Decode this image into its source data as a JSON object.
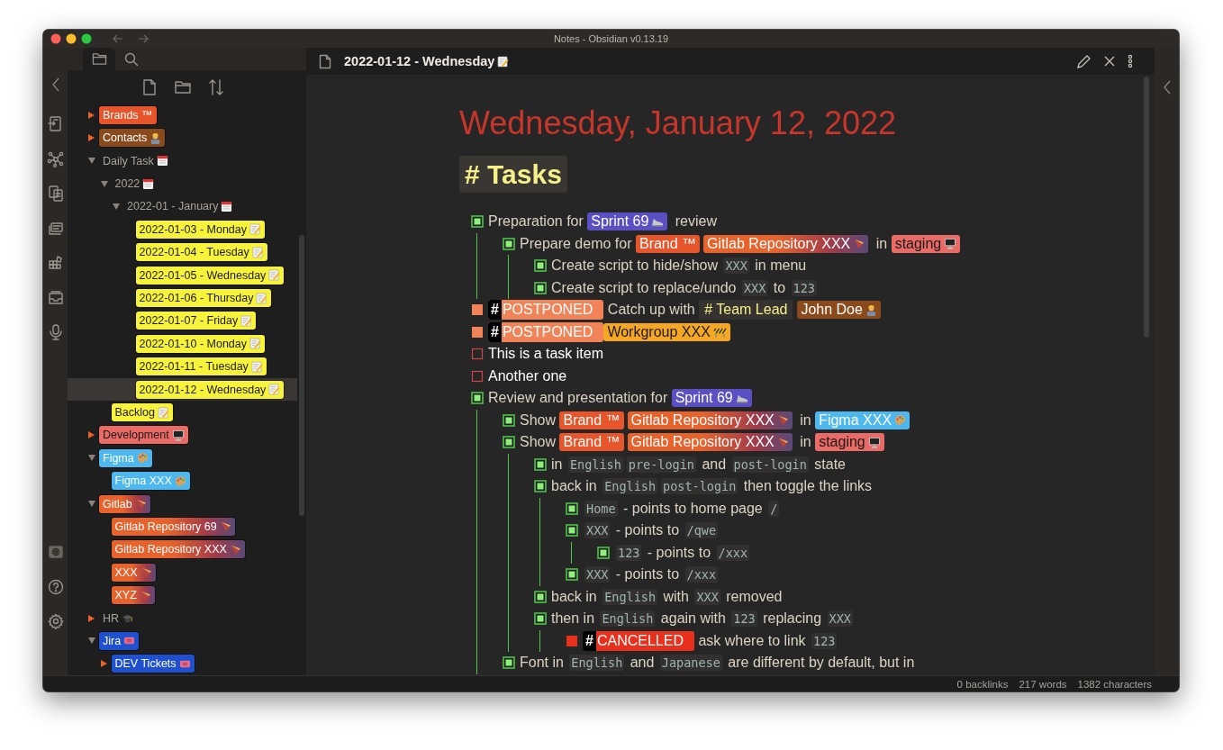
{
  "window": {
    "title": "Notes - Obsidian v0.13.19"
  },
  "sidebar_tabs": [
    {
      "kind": "files",
      "selected": true
    },
    {
      "kind": "search",
      "selected": false
    }
  ],
  "file_tree": [
    {
      "label": "Brands ™",
      "color": "#e8552a",
      "expanded": false,
      "selected": false
    },
    {
      "label": "Contacts",
      "icon": {
        "kind": "worker"
      },
      "color": "#8a4a1c",
      "expanded": false,
      "selected": false
    },
    {
      "label": "Daily Task",
      "icon": {
        "kind": "calendar"
      },
      "expanded": true,
      "selected": false,
      "children": [
        {
          "label": "2022",
          "icon": {
            "kind": "calendar"
          },
          "expanded": true,
          "selected": false,
          "children": [
            {
              "label": "2022-01 - January",
              "icon": {
                "kind": "calendar"
              },
              "expanded": true,
              "selected": false,
              "children": [
                {
                  "label": "2022-01-03 - Monday",
                  "icon": {
                    "kind": "note"
                  },
                  "color": "#f7f23a",
                  "selected": false
                },
                {
                  "label": "2022-01-04 - Tuesday",
                  "icon": {
                    "kind": "note"
                  },
                  "color": "#f7f23a",
                  "selected": false
                },
                {
                  "label": "2022-01-05 - Wednesday",
                  "icon": {
                    "kind": "note"
                  },
                  "color": "#f7f23a",
                  "selected": false
                },
                {
                  "label": "2022-01-06 - Thursday",
                  "icon": {
                    "kind": "note"
                  },
                  "color": "#f7f23a",
                  "selected": false
                },
                {
                  "label": "2022-01-07 - Friday",
                  "icon": {
                    "kind": "note"
                  },
                  "color": "#f7f23a",
                  "selected": false
                },
                {
                  "label": "2022-01-10 - Monday",
                  "icon": {
                    "kind": "note"
                  },
                  "color": "#f7f23a",
                  "selected": false
                },
                {
                  "label": "2022-01-11 - Tuesday",
                  "icon": {
                    "kind": "note"
                  },
                  "color": "#f7f23a",
                  "selected": false
                },
                {
                  "label": "2022-01-12 - Wednesday",
                  "icon": {
                    "kind": "note"
                  },
                  "color": "#f7f23a",
                  "selected": true
                }
              ]
            }
          ]
        },
        {
          "label": "Backlog",
          "icon": {
            "kind": "note"
          },
          "color": "#f7f23a",
          "selected": false
        }
      ]
    },
    {
      "label": "Development",
      "icon": {
        "kind": "monitor"
      },
      "color": "#ea6a66",
      "expanded": false,
      "selected": false
    },
    {
      "label": "Figma",
      "icon": {
        "kind": "palette"
      },
      "color": "#4db8f0",
      "expanded": true,
      "selected": false,
      "children": [
        {
          "label": "Figma XXX",
          "icon": {
            "kind": "palette"
          },
          "color": "#4db8f0",
          "selected": false
        }
      ]
    },
    {
      "label": "Gitlab",
      "icon": {
        "kind": "cone"
      },
      "color": "#e8622c",
      "gradient": true,
      "expanded": true,
      "selected": false,
      "children": [
        {
          "label": "Gitlab Repository 69",
          "icon": {
            "kind": "cone"
          },
          "color": "#e8622c",
          "gradient": true,
          "selected": false
        },
        {
          "label": "Gitlab Repository XXX",
          "icon": {
            "kind": "cone"
          },
          "color": "#e8622c",
          "gradient": true,
          "selected": false
        },
        {
          "label": "XXX",
          "icon": {
            "kind": "cone"
          },
          "color": "#e8622c",
          "gradient": true,
          "selected": false
        },
        {
          "label": "XYZ",
          "icon": {
            "kind": "cone"
          },
          "color": "#e8622c",
          "gradient": true,
          "selected": false
        }
      ]
    },
    {
      "label": "HR",
      "icon": {
        "kind": "cap"
      },
      "expanded": false,
      "selected": false
    },
    {
      "label": "Jira",
      "icon": {
        "kind": "ticket"
      },
      "color": "#1e50d0",
      "expanded": true,
      "selected": false,
      "children": [
        {
          "label": "DEV Tickets",
          "icon": {
            "kind": "ticket"
          },
          "color": "#1e50d0",
          "expanded": false,
          "selected": false
        }
      ]
    }
  ],
  "editor": {
    "tab_title": "2022-01-12 - Wednesday",
    "tab_icon": {
      "kind": "note"
    },
    "heading": "Wednesday, January 12, 2022",
    "section": "# Tasks",
    "tasks": [
      {
        "kind": "done",
        "parts": [
          {
            "kind": "text",
            "text": "Preparation for "
          },
          {
            "kind": "link",
            "text": "Sprint 69",
            "icon": {
              "kind": "shoe"
            },
            "color": "#5b4fc4"
          },
          {
            "kind": "text",
            "text": " review"
          }
        ],
        "children": [
          {
            "kind": "done",
            "parts": [
              {
                "kind": "text",
                "text": "Prepare demo for "
              },
              {
                "kind": "link",
                "text": "Brand ™",
                "color": "#e8552a"
              },
              {
                "kind": "link",
                "text": "Gitlab Repository XXX",
                "icon": {
                  "kind": "cone"
                },
                "color": "#e8622c",
                "gradient": true
              },
              {
                "kind": "text",
                "text": " in "
              },
              {
                "kind": "link",
                "text": "staging",
                "icon": {
                  "kind": "monitor"
                },
                "color": "#ea6a66"
              }
            ],
            "children": [
              {
                "kind": "done",
                "parts": [
                  {
                    "kind": "text",
                    "text": "Create script to hide/show "
                  },
                  {
                    "kind": "code",
                    "text": "XXX"
                  },
                  {
                    "kind": "text",
                    "text": " in menu"
                  }
                ]
              },
              {
                "kind": "done",
                "parts": [
                  {
                    "kind": "text",
                    "text": "Create script to replace/undo "
                  },
                  {
                    "kind": "code",
                    "text": "XXX"
                  },
                  {
                    "kind": "text",
                    "text": " to "
                  },
                  {
                    "kind": "code",
                    "text": "123"
                  }
                ]
              }
            ]
          }
        ]
      },
      {
        "kind": "postponed",
        "parts": [
          {
            "kind": "status-tag",
            "mark": "#",
            "text": "POSTPONED",
            "color": "#f08458"
          },
          {
            "kind": "text",
            "text": " Catch up with "
          },
          {
            "kind": "hashtag",
            "text": "# Team Lead"
          },
          {
            "kind": "link",
            "text": "John Doe",
            "icon": {
              "kind": "worker"
            },
            "color": "#8a4a1c"
          }
        ]
      },
      {
        "kind": "postponed",
        "parts": [
          {
            "kind": "status-tag",
            "mark": "#",
            "text": "POSTPONED",
            "color": "#f08458"
          },
          {
            "kind": "link",
            "text": "Workgroup XXX",
            "icon": {
              "kind": "barrier"
            },
            "color": "#f5a623"
          }
        ]
      },
      {
        "kind": "todo",
        "parts": [
          {
            "kind": "text",
            "text": "This is a task item"
          }
        ]
      },
      {
        "kind": "todo",
        "parts": [
          {
            "kind": "text",
            "text": "Another one"
          }
        ]
      },
      {
        "kind": "done",
        "parts": [
          {
            "kind": "text",
            "text": "Review and presentation for "
          },
          {
            "kind": "link",
            "text": "Sprint 69",
            "icon": {
              "kind": "shoe"
            },
            "color": "#5b4fc4"
          }
        ],
        "children": [
          {
            "kind": "done",
            "parts": [
              {
                "kind": "text",
                "text": "Show "
              },
              {
                "kind": "link",
                "text": "Brand ™",
                "color": "#e8552a"
              },
              {
                "kind": "link",
                "text": "Gitlab Repository XXX",
                "icon": {
                  "kind": "cone"
                },
                "color": "#e8622c",
                "gradient": true
              },
              {
                "kind": "text",
                "text": " in "
              },
              {
                "kind": "link",
                "text": "Figma XXX",
                "icon": {
                  "kind": "palette"
                },
                "color": "#4db8f0"
              }
            ]
          },
          {
            "kind": "done",
            "parts": [
              {
                "kind": "text",
                "text": "Show "
              },
              {
                "kind": "link",
                "text": "Brand ™",
                "color": "#e8552a"
              },
              {
                "kind": "link",
                "text": "Gitlab Repository XXX",
                "icon": {
                  "kind": "cone"
                },
                "color": "#e8622c",
                "gradient": true
              },
              {
                "kind": "text",
                "text": " in "
              },
              {
                "kind": "link",
                "text": "staging",
                "icon": {
                  "kind": "monitor"
                },
                "color": "#ea6a66"
              }
            ],
            "children": [
              {
                "kind": "done",
                "parts": [
                  {
                    "kind": "text",
                    "text": "in "
                  },
                  {
                    "kind": "code",
                    "text": "English"
                  },
                  {
                    "kind": "code",
                    "text": "pre-login"
                  },
                  {
                    "kind": "text",
                    "text": " and "
                  },
                  {
                    "kind": "code",
                    "text": "post-login"
                  },
                  {
                    "kind": "text",
                    "text": " state"
                  }
                ]
              },
              {
                "kind": "done",
                "parts": [
                  {
                    "kind": "text",
                    "text": "back in "
                  },
                  {
                    "kind": "code",
                    "text": "English"
                  },
                  {
                    "kind": "code",
                    "text": "post-login"
                  },
                  {
                    "kind": "text",
                    "text": " then toggle the links"
                  }
                ],
                "children": [
                  {
                    "kind": "done",
                    "parts": [
                      {
                        "kind": "code",
                        "text": "Home"
                      },
                      {
                        "kind": "text",
                        "text": " - points to home page "
                      },
                      {
                        "kind": "code",
                        "text": "/"
                      }
                    ]
                  },
                  {
                    "kind": "done",
                    "parts": [
                      {
                        "kind": "code",
                        "text": "XXX"
                      },
                      {
                        "kind": "text",
                        "text": " - points to "
                      },
                      {
                        "kind": "code",
                        "text": "/qwe"
                      }
                    ],
                    "children": [
                      {
                        "kind": "done",
                        "parts": [
                          {
                            "kind": "code",
                            "text": "123"
                          },
                          {
                            "kind": "text",
                            "text": " - points to "
                          },
                          {
                            "kind": "code",
                            "text": "/xxx"
                          }
                        ]
                      }
                    ]
                  },
                  {
                    "kind": "done",
                    "parts": [
                      {
                        "kind": "code",
                        "text": "XXX"
                      },
                      {
                        "kind": "text",
                        "text": " - points to "
                      },
                      {
                        "kind": "code",
                        "text": "/xxx"
                      }
                    ]
                  }
                ]
              },
              {
                "kind": "done",
                "parts": [
                  {
                    "kind": "text",
                    "text": "back in "
                  },
                  {
                    "kind": "code",
                    "text": "English"
                  },
                  {
                    "kind": "text",
                    "text": " with "
                  },
                  {
                    "kind": "code",
                    "text": "XXX"
                  },
                  {
                    "kind": "text",
                    "text": " removed"
                  }
                ]
              },
              {
                "kind": "done",
                "parts": [
                  {
                    "kind": "text",
                    "text": "then in "
                  },
                  {
                    "kind": "code",
                    "text": "English"
                  },
                  {
                    "kind": "text",
                    "text": " again with "
                  },
                  {
                    "kind": "code",
                    "text": "123"
                  },
                  {
                    "kind": "text",
                    "text": " replacing "
                  },
                  {
                    "kind": "code",
                    "text": "XXX"
                  }
                ],
                "children": [
                  {
                    "kind": "cancelled",
                    "parts": [
                      {
                        "kind": "status-tag",
                        "mark": "#",
                        "text": "CANCELLED",
                        "color": "#e8301c"
                      },
                      {
                        "kind": "text",
                        "text": " ask where to link "
                      },
                      {
                        "kind": "code",
                        "text": "123"
                      }
                    ]
                  }
                ]
              }
            ]
          },
          {
            "kind": "done",
            "parts": [
              {
                "kind": "text",
                "text": "Font in "
              },
              {
                "kind": "code",
                "text": "English"
              },
              {
                "kind": "text",
                "text": " and "
              },
              {
                "kind": "code",
                "text": "Japanese"
              },
              {
                "kind": "text",
                "text": " are different by default, but in"
              }
            ]
          }
        ]
      }
    ]
  },
  "status_bar": [
    "0 backlinks",
    "217 words",
    "1382 characters"
  ]
}
